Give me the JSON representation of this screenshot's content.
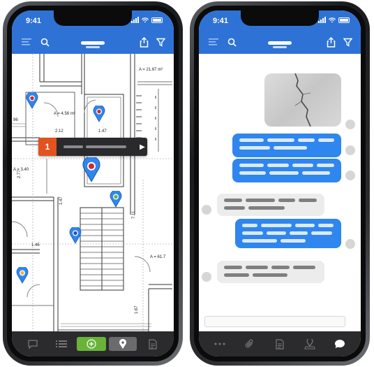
{
  "left_phone": {
    "status": {
      "time": "9:41"
    },
    "popup": {
      "number": "1"
    },
    "plan_labels": {
      "area1": "A = 21.67 m²",
      "area2": "A = 4.56 m²",
      "area3": "A = 3.40",
      "area4": "A = 61.7",
      "dim1": "1.47",
      "dim2": "2.12",
      "dim3": "1.46",
      "dim4": "7.11",
      "dim5": "1.47",
      "dim6": "1.67",
      "dim7": "2.77",
      "dim8": "96"
    },
    "bottom_bar": [
      "chat-icon",
      "list-icon",
      "add-icon",
      "location-icon",
      "document-icon"
    ]
  },
  "right_phone": {
    "status": {
      "time": "9:41"
    },
    "bottom_bar": [
      "more-icon",
      "attachment-icon",
      "document-icon",
      "user-location-icon",
      "chat-icon"
    ]
  },
  "colors": {
    "app_blue": "#2f72d6",
    "bubble_blue": "#2f86ee",
    "bubble_grey": "#ececec",
    "popup_orange": "#e2531f",
    "bar_dark": "#2b2b2e",
    "add_green": "#69b33a"
  }
}
